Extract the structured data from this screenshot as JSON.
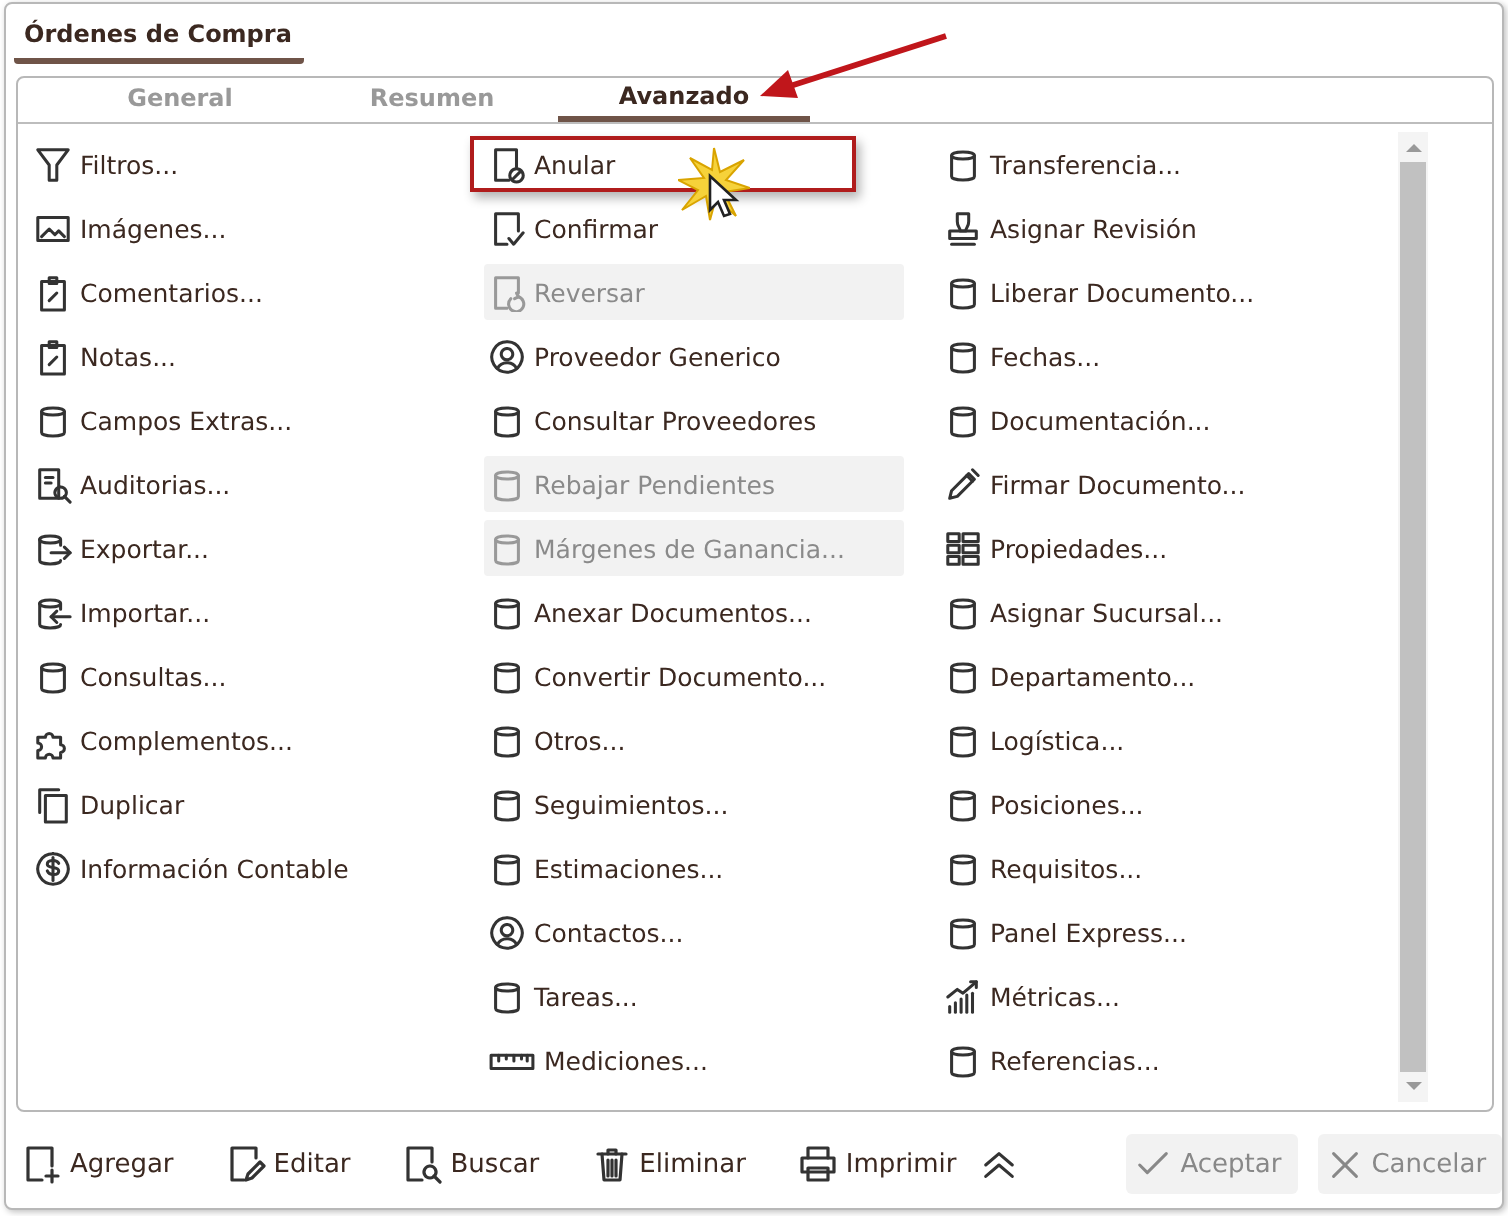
{
  "window": {
    "title": "Órdenes de Compra"
  },
  "tabs": [
    {
      "label": "General",
      "selected": false
    },
    {
      "label": "Resumen",
      "selected": false
    },
    {
      "label": "Avanzado",
      "selected": true
    }
  ],
  "columns": [
    [
      {
        "label": "Filtros...",
        "kind": "filter",
        "disabled": false,
        "highlighted": false
      },
      {
        "label": "Imágenes...",
        "kind": "image",
        "disabled": false,
        "highlighted": false
      },
      {
        "label": "Comentarios...",
        "kind": "clipboard",
        "disabled": false,
        "highlighted": false
      },
      {
        "label": "Notas...",
        "kind": "clipboard",
        "disabled": false,
        "highlighted": false
      },
      {
        "label": "Campos Extras...",
        "kind": "database",
        "disabled": false,
        "highlighted": false
      },
      {
        "label": "Auditorias...",
        "kind": "audit",
        "disabled": false,
        "highlighted": false
      },
      {
        "label": "Exportar...",
        "kind": "export",
        "disabled": false,
        "highlighted": false
      },
      {
        "label": "Importar...",
        "kind": "import",
        "disabled": false,
        "highlighted": false
      },
      {
        "label": "Consultas...",
        "kind": "database",
        "disabled": false,
        "highlighted": false
      },
      {
        "label": "Complementos...",
        "kind": "puzzle",
        "disabled": false,
        "highlighted": false
      },
      {
        "label": "Duplicar",
        "kind": "copy",
        "disabled": false,
        "highlighted": false
      },
      {
        "label": "Información Contable",
        "kind": "dollar",
        "disabled": false,
        "highlighted": false
      }
    ],
    [
      {
        "label": "Anular",
        "kind": "cancel",
        "disabled": false,
        "highlighted": true
      },
      {
        "label": "Confirmar",
        "kind": "confirm",
        "disabled": false,
        "highlighted": false
      },
      {
        "label": "Reversar",
        "kind": "undo",
        "disabled": true,
        "highlighted": false
      },
      {
        "label": "Proveedor Generico",
        "kind": "user",
        "disabled": false,
        "highlighted": false
      },
      {
        "label": "Consultar Proveedores",
        "kind": "database",
        "disabled": false,
        "highlighted": false
      },
      {
        "label": "Rebajar Pendientes",
        "kind": "database",
        "disabled": true,
        "highlighted": false
      },
      {
        "label": "Márgenes de Ganancia...",
        "kind": "database",
        "disabled": true,
        "highlighted": false
      },
      {
        "label": "Anexar Documentos...",
        "kind": "database",
        "disabled": false,
        "highlighted": false
      },
      {
        "label": "Convertir Documento...",
        "kind": "database",
        "disabled": false,
        "highlighted": false
      },
      {
        "label": "Otros...",
        "kind": "database",
        "disabled": false,
        "highlighted": false
      },
      {
        "label": "Seguimientos...",
        "kind": "database",
        "disabled": false,
        "highlighted": false
      },
      {
        "label": "Estimaciones...",
        "kind": "database",
        "disabled": false,
        "highlighted": false
      },
      {
        "label": "Contactos...",
        "kind": "user",
        "disabled": false,
        "highlighted": false
      },
      {
        "label": "Tareas...",
        "kind": "database",
        "disabled": false,
        "highlighted": false
      },
      {
        "label": "Mediciones...",
        "kind": "ruler",
        "disabled": false,
        "highlighted": false
      }
    ],
    [
      {
        "label": "Transferencia...",
        "kind": "database",
        "disabled": false,
        "highlighted": false
      },
      {
        "label": "Asignar Revisión",
        "kind": "stamp",
        "disabled": false,
        "highlighted": false
      },
      {
        "label": "Liberar Documento...",
        "kind": "database",
        "disabled": false,
        "highlighted": false
      },
      {
        "label": "Fechas...",
        "kind": "database",
        "disabled": false,
        "highlighted": false
      },
      {
        "label": "Documentación...",
        "kind": "database",
        "disabled": false,
        "highlighted": false
      },
      {
        "label": "Firmar Documento...",
        "kind": "pen",
        "disabled": false,
        "highlighted": false
      },
      {
        "label": "Propiedades...",
        "kind": "grid",
        "disabled": false,
        "highlighted": false
      },
      {
        "label": "Asignar Sucursal...",
        "kind": "database",
        "disabled": false,
        "highlighted": false
      },
      {
        "label": "Departamento...",
        "kind": "database",
        "disabled": false,
        "highlighted": false
      },
      {
        "label": "Logística...",
        "kind": "database",
        "disabled": false,
        "highlighted": false
      },
      {
        "label": "Posiciones...",
        "kind": "database",
        "disabled": false,
        "highlighted": false
      },
      {
        "label": "Requisitos...",
        "kind": "database",
        "disabled": false,
        "highlighted": false
      },
      {
        "label": "Panel Express...",
        "kind": "database",
        "disabled": false,
        "highlighted": false
      },
      {
        "label": "Métricas...",
        "kind": "chart",
        "disabled": false,
        "highlighted": false
      },
      {
        "label": "Referencias...",
        "kind": "database",
        "disabled": false,
        "highlighted": false
      }
    ]
  ],
  "toolbar": [
    {
      "kind": "action",
      "label": "Agregar"
    },
    {
      "kind": "action",
      "label": "Editar"
    },
    {
      "kind": "action",
      "label": "Buscar"
    },
    {
      "kind": "action",
      "label": "Eliminar"
    },
    {
      "kind": "action",
      "label": "Imprimir"
    },
    {
      "kind": "icon"
    },
    {
      "kind": "dialog",
      "label": "Aceptar"
    },
    {
      "kind": "dialog",
      "label": "Cancelar"
    }
  ]
}
